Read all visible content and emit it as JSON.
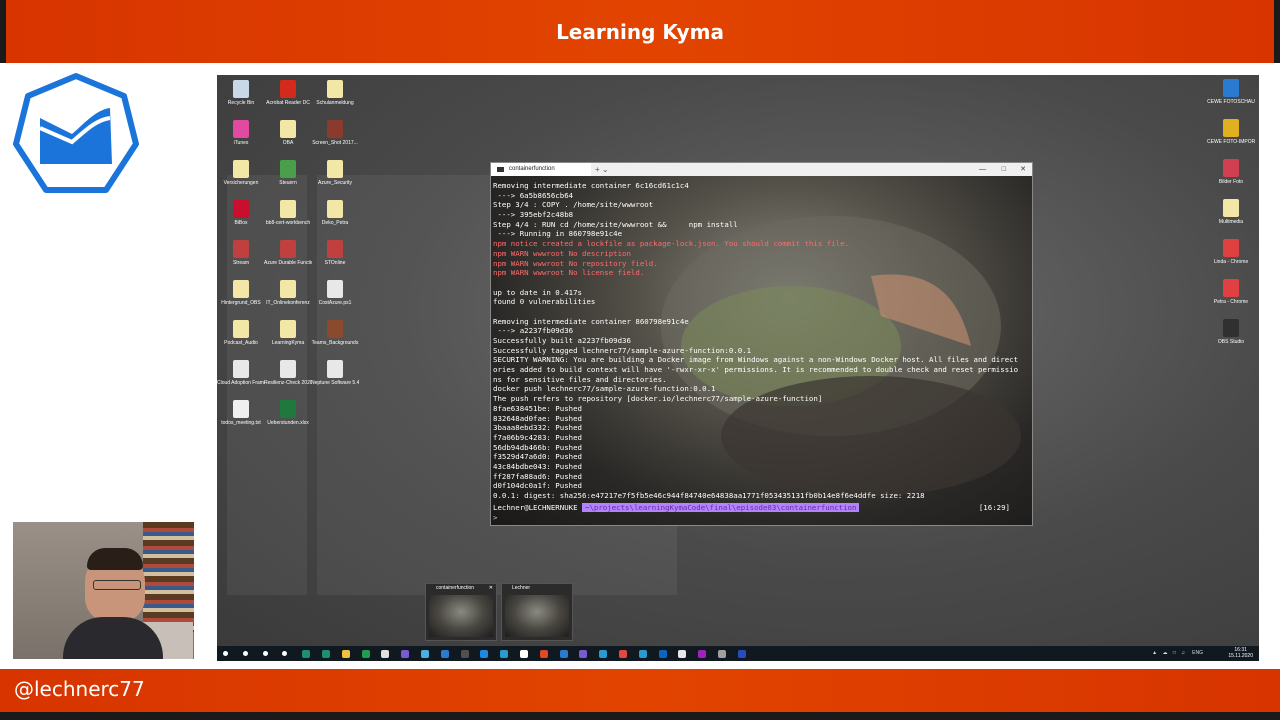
{
  "banner": {
    "title": "Learning Kyma",
    "handle": "@lechnerc77"
  },
  "colors": {
    "accent": "#e03c00",
    "kyma_blue": "#1a74d9",
    "terminal_warn": "#ff6b6b",
    "prompt_path_bg": "#b383ff"
  },
  "desktop_icons": [
    {
      "label": "Recycle Bin",
      "color": "#c9d8e8"
    },
    {
      "label": "Acrobat Reader DC",
      "color": "#d42a1c"
    },
    {
      "label": "Schulanmeldung",
      "color": "#f3e7a8"
    },
    {
      "label": "iTunes",
      "color": "#e04aa0"
    },
    {
      "label": "OBA",
      "color": "#f3e7a8"
    },
    {
      "label": "Screen_Shot 2017...",
      "color": "#8b3a2c"
    },
    {
      "label": "Versicherungen",
      "color": "#f3e7a8"
    },
    {
      "label": "Steuern",
      "color": "#4aa04a"
    },
    {
      "label": "Azure_Security",
      "color": "#f3e7a8"
    },
    {
      "label": "BiBox",
      "color": "#c8102e"
    },
    {
      "label": "bb8-cert-workbench",
      "color": "#f3e7a8"
    },
    {
      "label": "Deko_Petra",
      "color": "#f3e7a8"
    },
    {
      "label": "Stream",
      "color": "#c04040"
    },
    {
      "label": "Azure Durable Functions",
      "color": "#c04040"
    },
    {
      "label": "STOnline",
      "color": "#c04040"
    },
    {
      "label": "Hintergrund_OBS",
      "color": "#f3e7a8"
    },
    {
      "label": "IT_Onlinekonferenz",
      "color": "#f3e7a8"
    },
    {
      "label": "CostAzure.ps1",
      "color": "#e8e8e8"
    },
    {
      "label": "Podcast_Audio",
      "color": "#f3e7a8"
    },
    {
      "label": "LearningKyma",
      "color": "#f3e7a8"
    },
    {
      "label": "Teams_Backgrounds",
      "color": "#8b4a2c"
    },
    {
      "label": "Cloud Adoption Framework - Platfo...",
      "color": "#e8e8e8"
    },
    {
      "label": "Resilienz-Check 2020",
      "color": "#e8e8e8"
    },
    {
      "label": "Neptune Software 5.4 Sneak Whitepap...",
      "color": "#e8e8e8"
    },
    {
      "label": "todos_meeting.txt",
      "color": "#f0f0f0"
    },
    {
      "label": "Ueberstunden.xlsx",
      "color": "#1e7a3c"
    }
  ],
  "right_icons": [
    {
      "label": "CEWE FOTOSCHAU",
      "color": "#2a7ad0"
    },
    {
      "label": "CEWE FOTO-IMPORTER",
      "color": "#e0b020"
    },
    {
      "label": "Bilder Foto",
      "color": "#d04050"
    },
    {
      "label": "Multimedia",
      "color": "#f3e7a8"
    },
    {
      "label": "Linda - Chrome",
      "color": "#e04040"
    },
    {
      "label": "Petra - Chrome",
      "color": "#e04040"
    },
    {
      "label": "OBS Studio",
      "color": "#303030"
    }
  ],
  "terminal": {
    "tab_title": "containerfunction",
    "lines": [
      {
        "text": "Removing intermediate container 6c16cd61c1c4",
        "warn": false
      },
      {
        "text": " ---> 6a5b8656cb64",
        "warn": false
      },
      {
        "text": "Step 3/4 : COPY . /home/site/wwwroot",
        "warn": false
      },
      {
        "text": " ---> 395ebf2c48b8",
        "warn": false
      },
      {
        "text": "Step 4/4 : RUN cd /home/site/wwwroot &&     npm install",
        "warn": false
      },
      {
        "text": " ---> Running in 860798e91c4e",
        "warn": false
      },
      {
        "text": "npm notice created a lockfile as package-lock.json. You should commit this file.",
        "warn": true
      },
      {
        "text": "npm WARN wwwroot No description",
        "warn": true
      },
      {
        "text": "npm WARN wwwroot No repository field.",
        "warn": true
      },
      {
        "text": "npm WARN wwwroot No license field.",
        "warn": true
      },
      {
        "text": "",
        "warn": false
      },
      {
        "text": "up to date in 0.417s",
        "warn": false
      },
      {
        "text": "found 0 vulnerabilities",
        "warn": false
      },
      {
        "text": "",
        "warn": false
      },
      {
        "text": "Removing intermediate container 860798e91c4e",
        "warn": false
      },
      {
        "text": " ---> a2237fb09d36",
        "warn": false
      },
      {
        "text": "Successfully built a2237fb09d36",
        "warn": false
      },
      {
        "text": "Successfully tagged lechnerc77/sample-azure-function:0.0.1",
        "warn": false
      },
      {
        "text": "SECURITY WARNING: You are building a Docker image from Windows against a non-Windows Docker host. All files and direct",
        "warn": false
      },
      {
        "text": "ories added to build context will have '-rwxr-xr-x' permissions. It is recommended to double check and reset permissio",
        "warn": false
      },
      {
        "text": "ns for sensitive files and directories.",
        "warn": false
      },
      {
        "text": "docker push lechnerc77/sample-azure-function:0.0.1",
        "warn": false
      },
      {
        "text": "The push refers to repository [docker.io/lechnerc77/sample-azure-function]",
        "warn": false
      },
      {
        "text": "8fae638451be: Pushed",
        "warn": false
      },
      {
        "text": "832648ad0fae: Pushed",
        "warn": false
      },
      {
        "text": "3baaa8ebd332: Pushed",
        "warn": false
      },
      {
        "text": "f7a06b9c4283: Pushed",
        "warn": false
      },
      {
        "text": "56db94db466b: Pushed",
        "warn": false
      },
      {
        "text": "f3529d47a6d0: Pushed",
        "warn": false
      },
      {
        "text": "43c84bdbe043: Pushed",
        "warn": false
      },
      {
        "text": "ff287fa88ad6: Pushed",
        "warn": false
      },
      {
        "text": "d0f104dc0a1f: Pushed",
        "warn": false
      },
      {
        "text": "0.0.1: digest: sha256:e47217e7f5fb5e46c944f84740e64838aa1771f053435131fb0b14e8f6e4ddfe size: 2218",
        "warn": false
      }
    ],
    "prompt_user": "Lechner@LECHNERNUKE",
    "prompt_path": "~\\projects\\learningKymaCode\\final\\episode03\\containerfunction",
    "prompt_time": "[16:29]",
    "cursor": ">"
  },
  "taskbar_thumbs": [
    {
      "title": "containerfunction"
    },
    {
      "title": "Lechner"
    }
  ],
  "taskbar": {
    "lang": "ENG",
    "time": "16:31",
    "date": "15.11.2020",
    "icon_colors": [
      "#ffffff",
      "#ffffff",
      "#ffffff",
      "#ffffff",
      "#1e8f6e",
      "#1e8f6e",
      "#f0c040",
      "#1aa04a",
      "#e0e0e0",
      "#7a5ad0",
      "#4ab0e0",
      "#2a7ad0",
      "#505050",
      "#1e88e5",
      "#2a9ad0",
      "#ffffff",
      "#e04a2a",
      "#2a7ad0",
      "#7a5ad0",
      "#2a9ad0",
      "#e04a40",
      "#2a9ad0",
      "#0a66c2",
      "#e8e8e8",
      "#a020c0",
      "#a0a0a0",
      "#2a4ac0"
    ]
  }
}
